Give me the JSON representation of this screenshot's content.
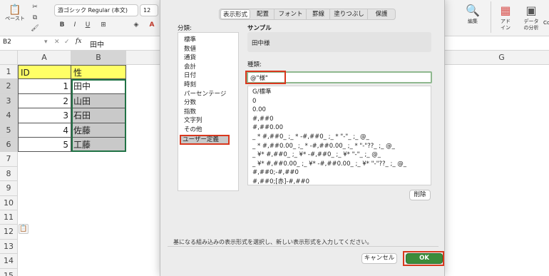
{
  "ribbon": {
    "paste_label": "ペースト",
    "font_name": "游ゴシック Regular (本文)",
    "font_size": "12",
    "edit_label": "編集",
    "addin_label": "アド\nイン",
    "data_analysis_label": "データ\nの分析",
    "copilot_partial": "Co"
  },
  "formula_bar": {
    "cell_ref": "B2",
    "fx_label": "fx",
    "value": "田中"
  },
  "sheet": {
    "col_a": "A",
    "col_b": "B",
    "col_g": "G",
    "rows": [
      "1",
      "2",
      "3",
      "4",
      "5",
      "6",
      "7",
      "8",
      "9",
      "10",
      "11",
      "12",
      "13",
      "14",
      "15"
    ],
    "cells": [
      {
        "a": "ID",
        "b": "性"
      },
      {
        "a": "1",
        "b": "田中"
      },
      {
        "a": "2",
        "b": "山田"
      },
      {
        "a": "3",
        "b": "石田"
      },
      {
        "a": "4",
        "b": "佐藤"
      },
      {
        "a": "5",
        "b": "工藤"
      }
    ],
    "header_color": "#ffff66",
    "selected_color": "#c9c9c9",
    "selection_border": "#217346"
  },
  "dialog": {
    "tabs": [
      "表示形式",
      "配置",
      "フォント",
      "罫線",
      "塗りつぶし",
      "保護"
    ],
    "category_label": "分類:",
    "categories": [
      "標準",
      "数値",
      "通貨",
      "会計",
      "日付",
      "時刻",
      "パーセンテージ",
      "分数",
      "指数",
      "文字列",
      "その他",
      "ユーザー定義"
    ],
    "sample_label": "サンプル",
    "sample_value": "田中様",
    "type_label": "種類:",
    "type_value": "@\"様\"",
    "formats": [
      "G/標準",
      "0",
      "0.00",
      "#,##0",
      "#,##0.00",
      "_ * #,##0_ ;_ * -#,##0_ ;_ * \"-\"_ ;_ @_",
      "_ * #,##0.00_ ;_ * -#,##0.00_ ;_ * \"-\"??_ ;_ @_",
      "_ ¥* #,##0_ ;_ ¥* -#,##0_ ;_ ¥* \"-\"_ ;_ @_",
      "_ ¥* #,##0.00_ ;_ ¥* -#,##0.00_ ;_ ¥* \"-\"??_ ;_ @_",
      "#,##0;-#,##0",
      "#,##0;[赤]-#,##0"
    ],
    "delete_label": "削除",
    "hint": "基になる組み込みの表示形式を選択し、新しい表示形式を入力してください。",
    "cancel_label": "キャンセル",
    "ok_label": "OK",
    "ok_color": "#3b8c3b",
    "highlight_color": "#d9381e"
  }
}
